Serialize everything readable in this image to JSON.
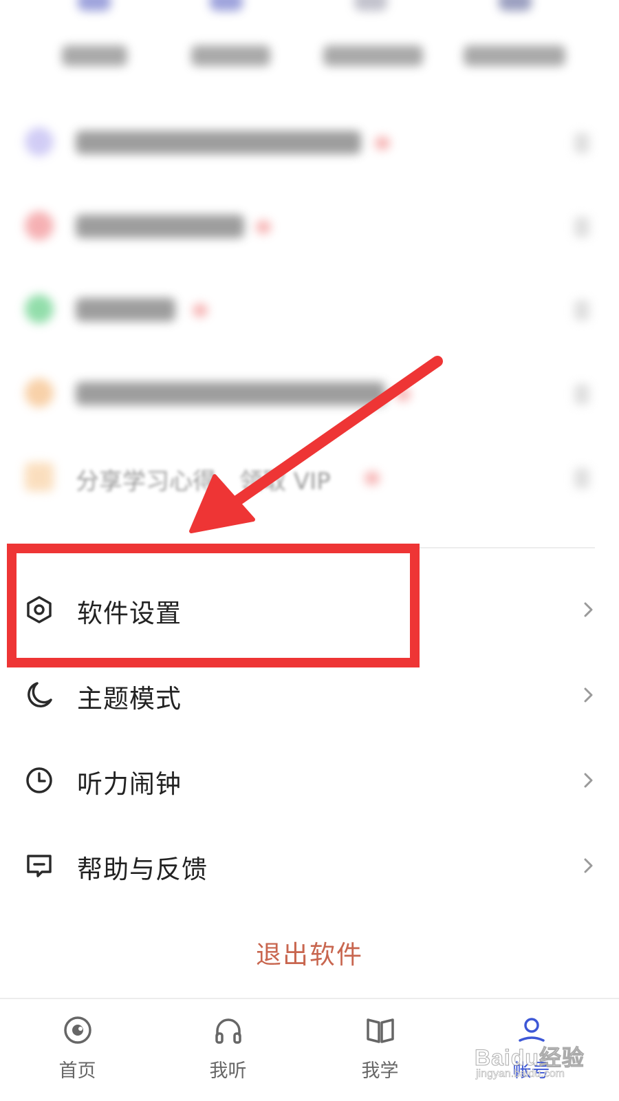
{
  "promo_visible_text": "分享学习心得，领取 VIP",
  "settings_menu": [
    {
      "label": "软件设置",
      "icon": "settings-hexagon-icon"
    },
    {
      "label": "主题模式",
      "icon": "moon-icon"
    },
    {
      "label": "听力闹钟",
      "icon": "clock-icon"
    },
    {
      "label": "帮助与反馈",
      "icon": "feedback-icon"
    }
  ],
  "logout_label": "退出软件",
  "bottom_nav": [
    {
      "label": "首页",
      "icon": "home-icon",
      "active": false
    },
    {
      "label": "我听",
      "icon": "headphones-icon",
      "active": false
    },
    {
      "label": "我学",
      "icon": "book-icon",
      "active": false
    },
    {
      "label": "帐号",
      "icon": "account-icon",
      "active": true
    }
  ],
  "watermark": {
    "main": "Baidu经验",
    "sub": "jingyan.baidu.com"
  },
  "colors": {
    "accent_blue": "#3d57d6",
    "logout_red": "#c8664f",
    "annotation_red": "#ee3535",
    "text": "#222222"
  }
}
